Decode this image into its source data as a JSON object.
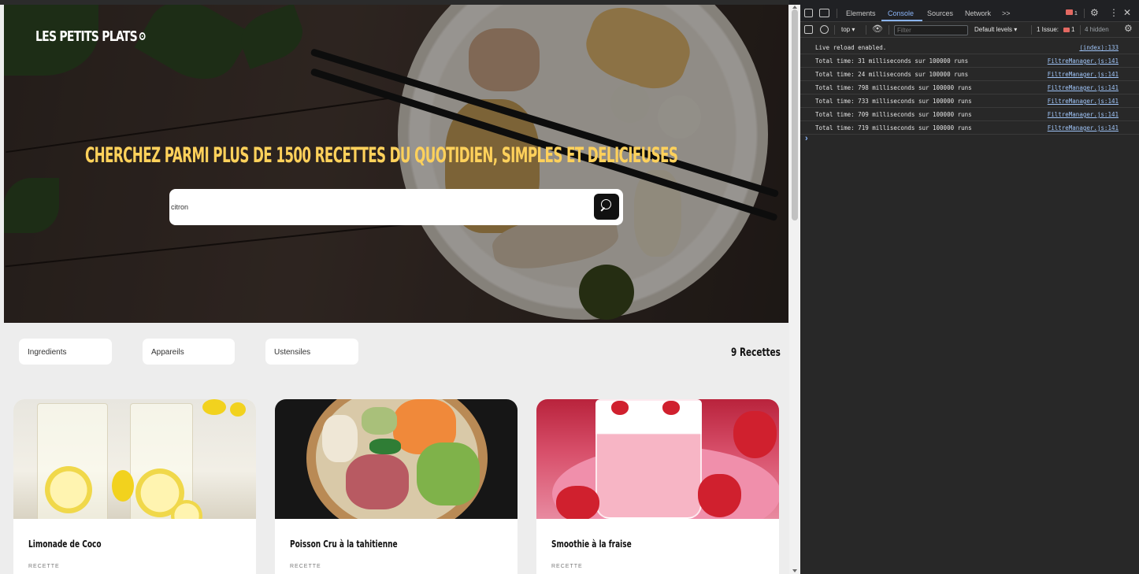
{
  "site": {
    "logo": "LES PETITS PLATS",
    "headline": "CHERCHEZ PARMI PLUS DE 1500 RECETTES DU QUOTIDIEN, SIMPLES ET DELICIEUSES",
    "search": {
      "value": "citron"
    },
    "filters": [
      "Ingredients",
      "Appareils",
      "Ustensiles"
    ],
    "recipe_count": "9 Recettes",
    "cards": [
      {
        "title": "Limonade de Coco",
        "subtitle": "RECETTE"
      },
      {
        "title": "Poisson Cru à la tahitienne",
        "subtitle": "RECETTE"
      },
      {
        "title": "Smoothie à la fraise",
        "subtitle": "RECETTE"
      }
    ]
  },
  "devtools": {
    "tabs": [
      "Elements",
      "Console",
      "Sources",
      "Network",
      ">>"
    ],
    "active_tab": "Console",
    "error_count": "1",
    "context": "top ▾",
    "filter_placeholder": "Filter",
    "levels": "Default levels ▾",
    "issues_label": "1 Issue:",
    "issues_count": "1",
    "hidden": "4 hidden",
    "logs": [
      {
        "message": "Live reload enabled.",
        "source": "(index):133"
      },
      {
        "message": "Total time: 31 milliseconds sur 100000 runs",
        "source": "FiltreManager.js:141"
      },
      {
        "message": "Total time: 24 milliseconds sur 100000 runs",
        "source": "FiltreManager.js:141"
      },
      {
        "message": "Total time: 798 milliseconds sur 100000 runs",
        "source": "FiltreManager.js:141"
      },
      {
        "message": "Total time: 733 milliseconds sur 100000 runs",
        "source": "FiltreManager.js:141"
      },
      {
        "message": "Total time: 709 milliseconds sur 100000 runs",
        "source": "FiltreManager.js:141"
      },
      {
        "message": "Total time: 719 milliseconds sur 100000 runs",
        "source": "FiltreManager.js:141"
      }
    ],
    "prompt": "›"
  },
  "colors": {
    "accent": "#ffd15b",
    "devtools_bg": "#282828",
    "link": "#9fc4f7"
  }
}
